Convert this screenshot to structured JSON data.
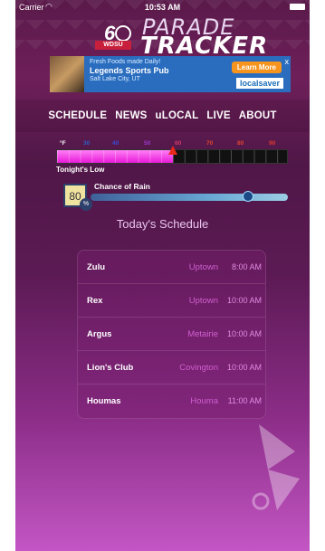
{
  "status_bar": {
    "carrier": "Carrier",
    "time": "10:53 AM"
  },
  "header": {
    "channel_number": "6",
    "call_sign": "WDSU",
    "title_line1": "PARADE",
    "title_line2": "TRACKER"
  },
  "ad": {
    "line1": "Fresh Foods made Daily!",
    "line2": "Legends Sports Pub",
    "line3": "Salt Lake City, UT",
    "cta": "Learn More",
    "brand": "localsaver",
    "close": "x"
  },
  "nav": {
    "items": [
      "SCHEDULE",
      "NEWS",
      "uLOCAL",
      "LIVE",
      "ABOUT"
    ]
  },
  "temperature": {
    "unit_label": "°F",
    "ticks": [
      "30",
      "40",
      "50",
      "60",
      "70",
      "80",
      "90"
    ],
    "tonight_value": 60,
    "label": "Tonight's Low"
  },
  "rain": {
    "value": "80",
    "percent_symbol": "%",
    "label": "Chance of Rain",
    "fraction": 0.8
  },
  "schedule": {
    "title": "Today's Schedule",
    "rows": [
      {
        "name": "Zulu",
        "location": "Uptown",
        "time": "8:00 AM"
      },
      {
        "name": "Rex",
        "location": "Uptown",
        "time": "10:00 AM"
      },
      {
        "name": "Argus",
        "location": "Metairie",
        "time": "10:00 AM"
      },
      {
        "name": "Lion's Club",
        "location": "Covington",
        "time": "10:00 AM"
      },
      {
        "name": "Houmas",
        "location": "Houma",
        "time": "11:00 AM"
      }
    ]
  },
  "colors": {
    "accent_pink": "#e81ad8",
    "marker_red": "#e8291c",
    "nav_text": "#ffffff"
  }
}
